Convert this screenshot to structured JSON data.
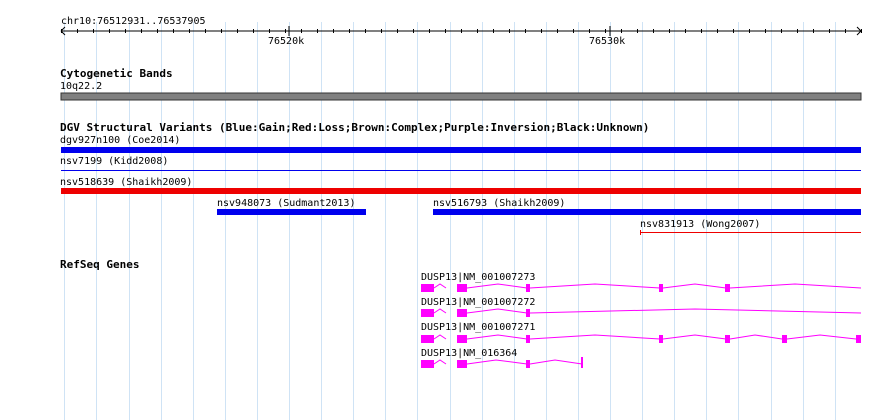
{
  "ruler": {
    "range_label": "chr10:76512931..76537905",
    "ticks": [
      {
        "label": "76520k",
        "pos": 76520000
      },
      {
        "label": "76530k",
        "pos": 76530000
      }
    ],
    "start": 76512931,
    "end": 76537905
  },
  "cytoband": {
    "title": "Cytogenetic Bands",
    "band_label": "10q22.2",
    "color": "#808080"
  },
  "dgv": {
    "title": "DGV Structural Variants (Blue:Gain;Red:Loss;Brown:Complex;Purple:Inversion;Black:Unknown)",
    "colors": {
      "gain": "#0000ee",
      "loss": "#ee0000"
    },
    "variants": [
      {
        "label": "dgv927n100 (Coe2014)",
        "type": "gain",
        "weight": "thick"
      },
      {
        "label": "nsv7199 (Kidd2008)",
        "type": "gain",
        "weight": "thin"
      },
      {
        "label": "nsv518639 (Shaikh2009)",
        "type": "loss",
        "weight": "thick"
      },
      {
        "label": "nsv948073 (Sudmant2013)",
        "type": "gain",
        "weight": "thick"
      },
      {
        "label": "nsv516793 (Shaikh2009)",
        "type": "gain",
        "weight": "thick"
      },
      {
        "label": "nsv831913 (Wong2007)",
        "type": "loss",
        "weight": "thin"
      }
    ]
  },
  "refseq": {
    "title": "RefSeq Genes",
    "color": "#ff00ff",
    "genes": [
      {
        "label": "DUSP13|NM_001007273"
      },
      {
        "label": "DUSP13|NM_001007272"
      },
      {
        "label": "DUSP13|NM_001007271"
      },
      {
        "label": "DUSP13|NM_016364"
      }
    ]
  }
}
